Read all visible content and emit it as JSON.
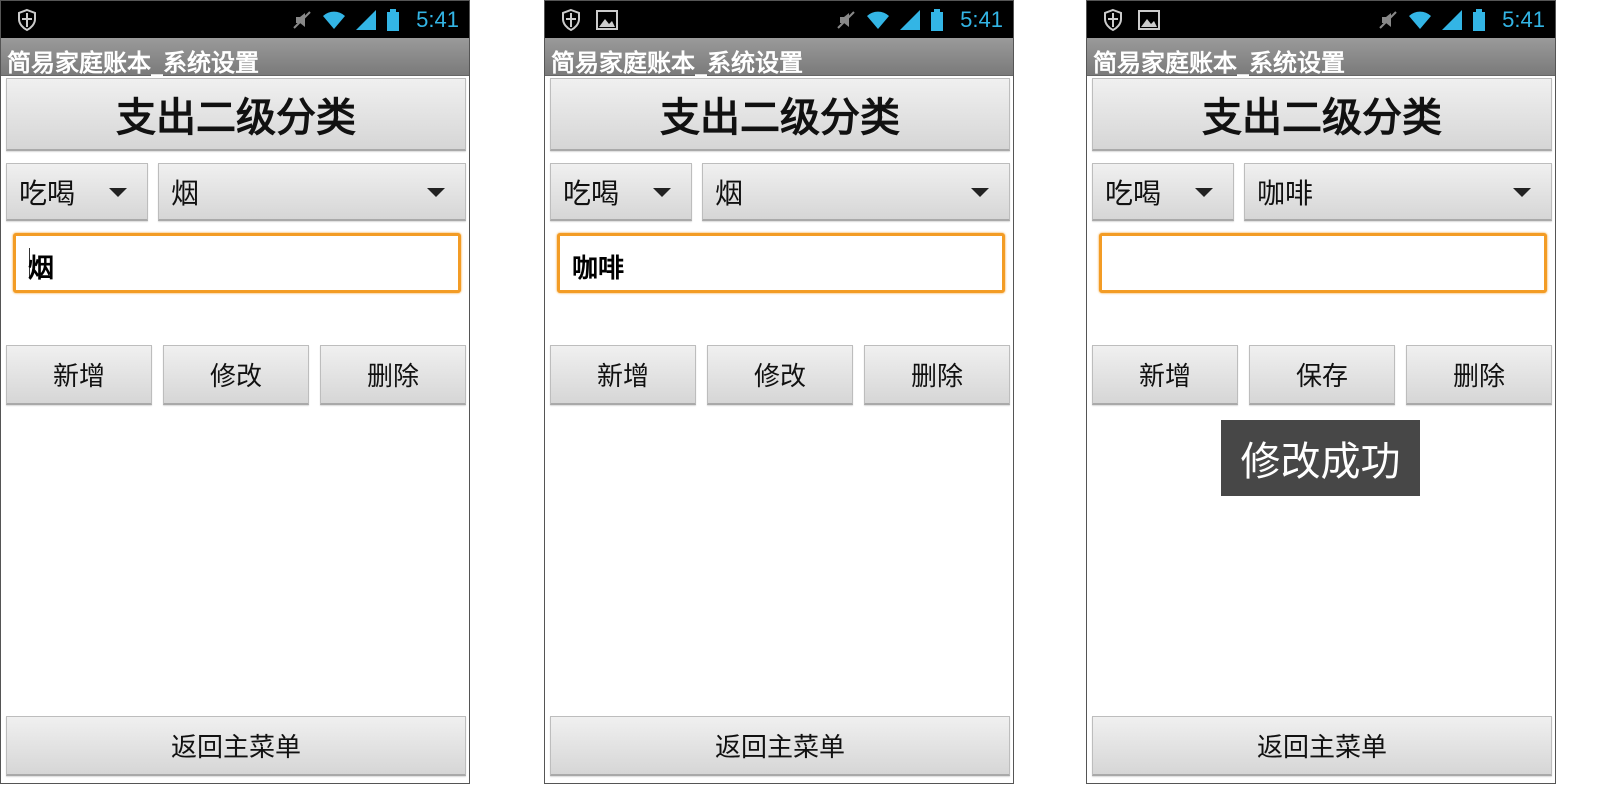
{
  "status_time": "5:41",
  "app_title": "简易家庭账本_系统设置",
  "accent_color": "#33b5e5",
  "focus_color": "#f39c25",
  "screens": [
    {
      "header": "支出二级分类",
      "spinner_category": "吃喝",
      "spinner_subcategory": "烟",
      "input_value": "烟",
      "buttons": [
        "新增",
        "修改",
        "删除"
      ],
      "return_label": "返回主菜单",
      "toast": ""
    },
    {
      "header": "支出二级分类",
      "spinner_category": "吃喝",
      "spinner_subcategory": "烟",
      "input_value": "咖啡",
      "buttons": [
        "新增",
        "修改",
        "删除"
      ],
      "return_label": "返回主菜单",
      "toast": ""
    },
    {
      "header": "支出二级分类",
      "spinner_category": "吃喝",
      "spinner_subcategory": "咖啡",
      "input_value": "",
      "buttons": [
        "新增",
        "保存",
        "删除"
      ],
      "return_label": "返回主菜单",
      "toast": "修改成功"
    }
  ]
}
